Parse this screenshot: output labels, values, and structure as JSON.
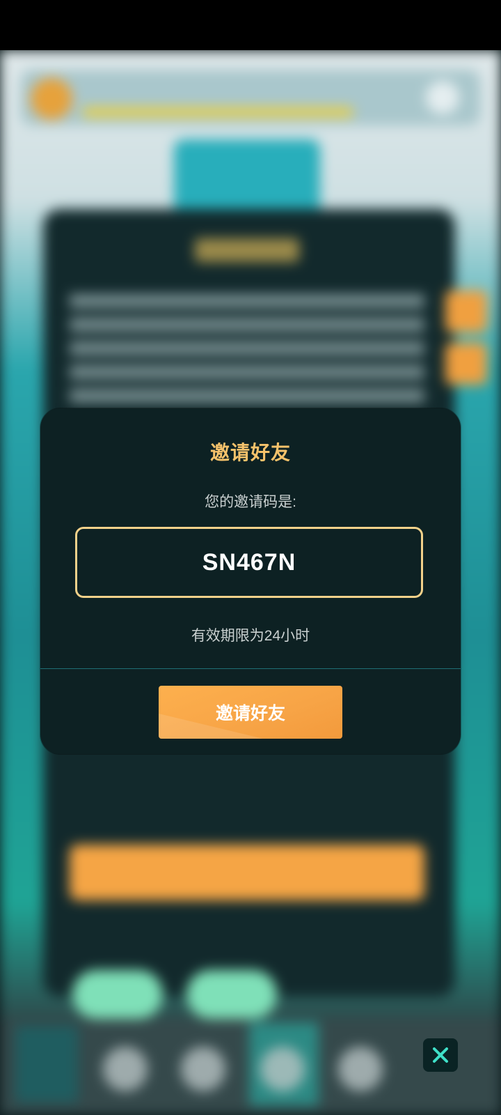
{
  "dialog": {
    "title": "邀请好友",
    "subtitle": "您的邀请码是:",
    "invite_code": "SN467N",
    "validity_text": "有效期限为24小时",
    "invite_button_label": "邀请好友"
  },
  "colors": {
    "title": "#f5c26b",
    "code_border": "#f2d18a",
    "button": "#f7a446",
    "dialog_bg": "#0d2123"
  },
  "icons": {
    "close": "close-icon"
  }
}
